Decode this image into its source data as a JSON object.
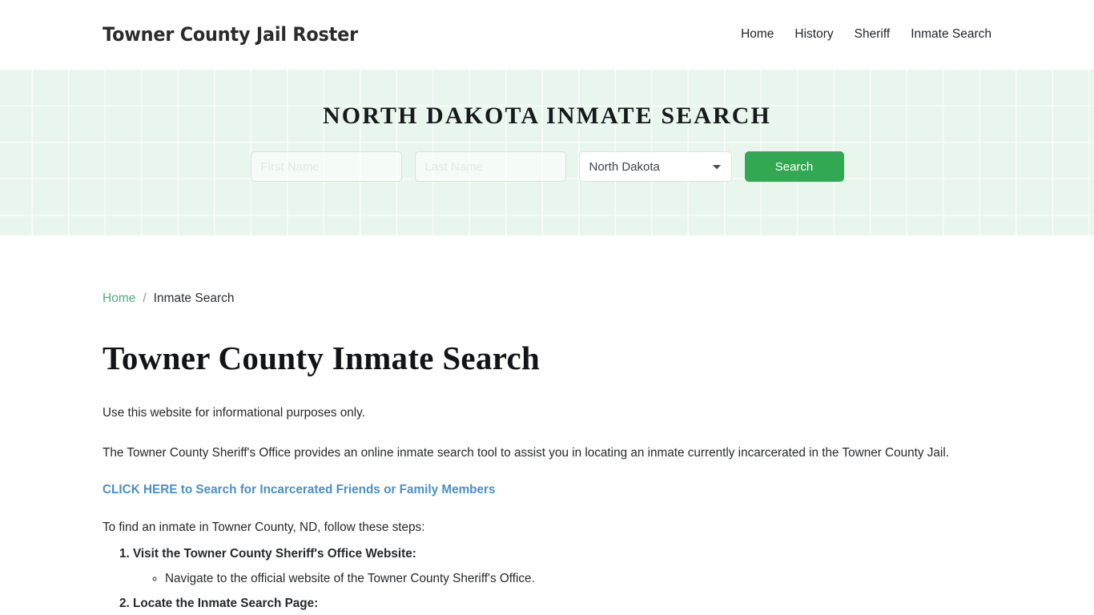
{
  "header": {
    "brand": "Towner County Jail Roster",
    "nav": [
      {
        "label": "Home"
      },
      {
        "label": "History"
      },
      {
        "label": "Sheriff"
      },
      {
        "label": "Inmate Search"
      }
    ]
  },
  "hero": {
    "title": "NORTH DAKOTA INMATE SEARCH",
    "first_name_placeholder": "First Name",
    "first_name_value": "",
    "last_name_placeholder": "Last Name",
    "last_name_value": "",
    "state_selected": "North Dakota",
    "state_options": [
      "North Dakota"
    ],
    "search_label": "Search",
    "accent_color": "#32a852",
    "background_color": "#e9f6ee"
  },
  "breadcrumb": {
    "home": "Home",
    "separator": "/",
    "current": "Inmate Search"
  },
  "main": {
    "title": "Towner County Inmate Search",
    "paragraph_1": "Use this website for informational purposes only.",
    "paragraph_2": "The Towner County Sheriff's Office provides an online inmate search tool to assist you in locating an inmate currently incarcerated in the Towner County Jail.",
    "cta_link": "CLICK HERE to Search for Incarcerated Friends or Family Members",
    "cta_color": "#4a90c8",
    "paragraph_3": "To find an inmate in Towner County, ND, follow these steps:",
    "steps": [
      {
        "label": "Visit the Towner County Sheriff's Office Website:",
        "sub": [
          "Navigate to the official website of the Towner County Sheriff's Office."
        ]
      },
      {
        "label": "Locate the Inmate Search Page:",
        "sub": []
      }
    ]
  }
}
